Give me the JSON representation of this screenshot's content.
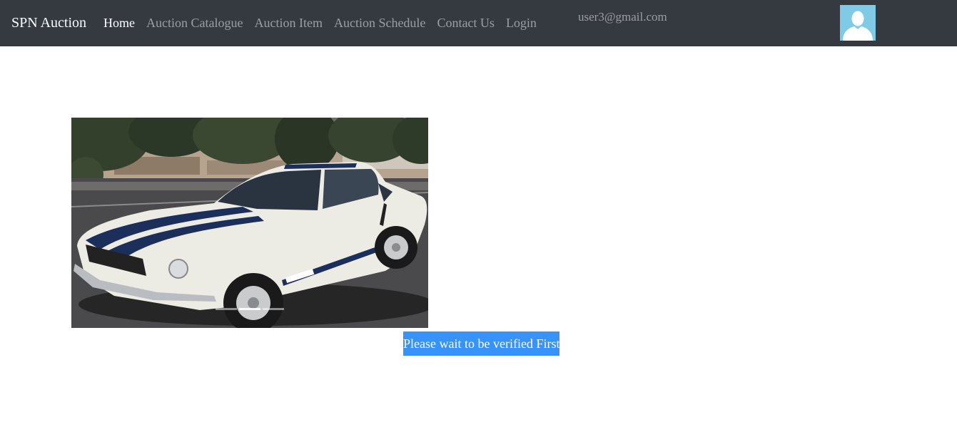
{
  "navbar": {
    "brand": "SPN Auction",
    "links": [
      {
        "label": "Home",
        "active": true
      },
      {
        "label": "Auction Catalogue",
        "active": false
      },
      {
        "label": "Auction Item",
        "active": false
      },
      {
        "label": "Auction Schedule",
        "active": false
      },
      {
        "label": "Contact Us",
        "active": false
      },
      {
        "label": "Login",
        "active": false
      }
    ],
    "user_email": "user3@gmail.com",
    "avatar_icon": "user-silhouette-icon"
  },
  "carousel": {
    "image_subject": "white-shelby-gt350-car-photo",
    "indicators": [
      {
        "active": false
      },
      {
        "active": true
      },
      {
        "active": false
      }
    ]
  },
  "status_button": {
    "label": "Please wait to be verified First"
  },
  "colors": {
    "navbar_bg": "#343a40",
    "button_bg": "#3793fa",
    "avatar_bg": "#7fcbe6"
  }
}
